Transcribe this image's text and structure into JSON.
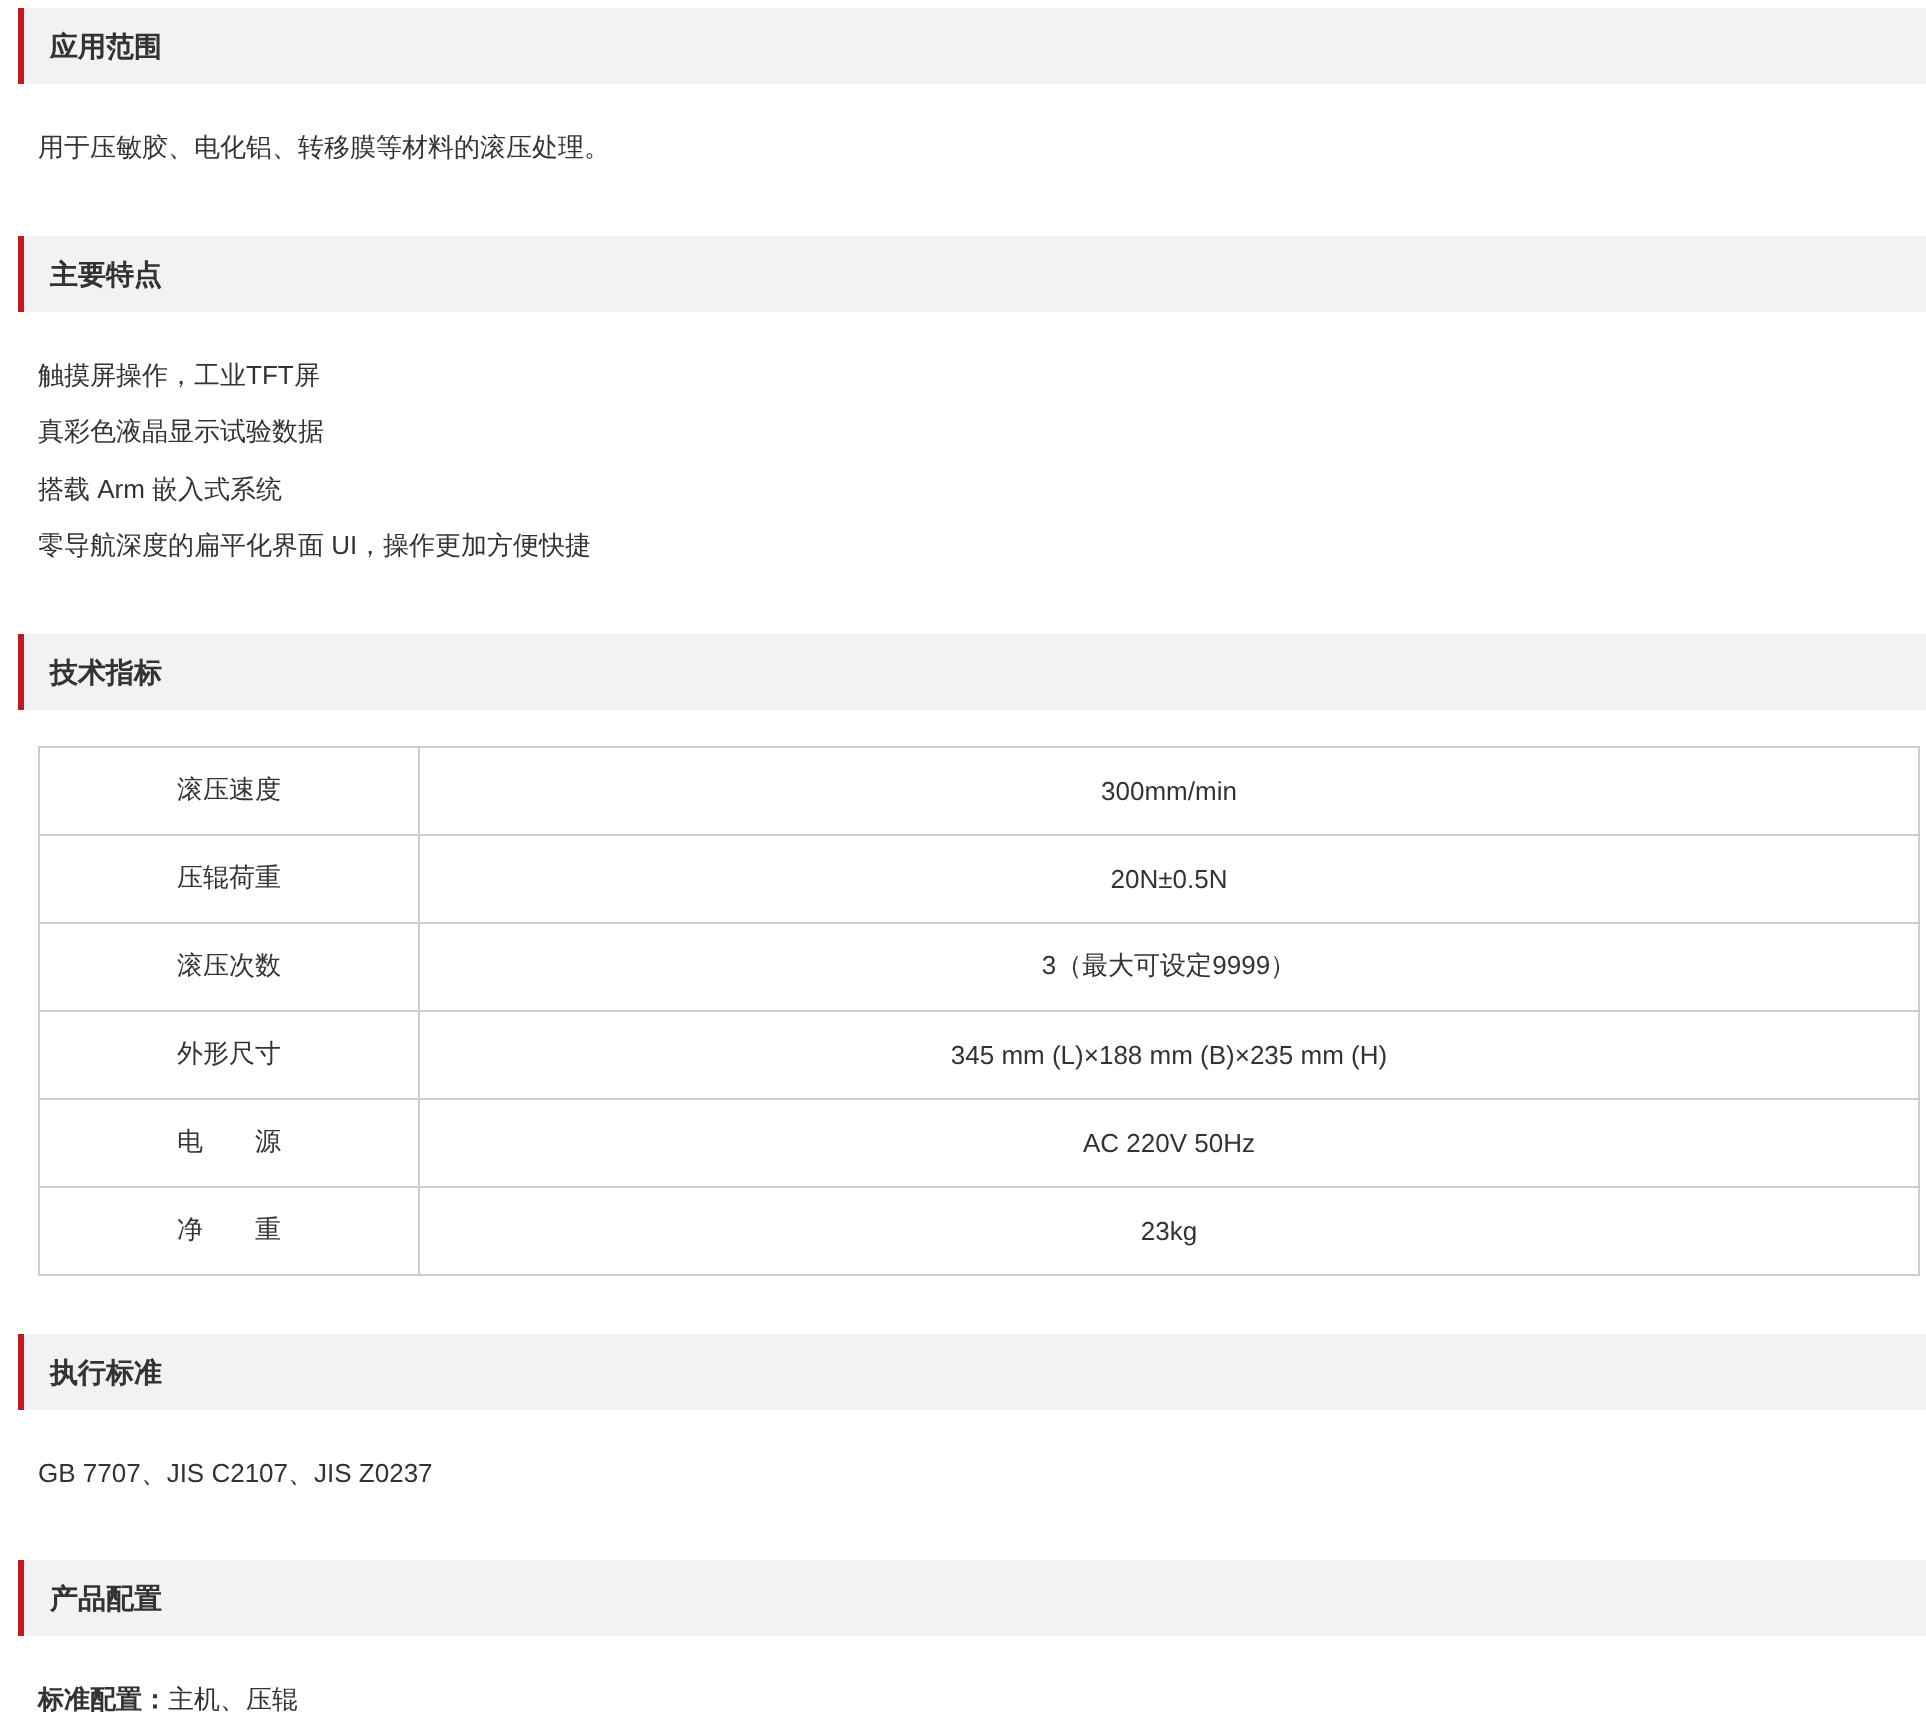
{
  "sections": [
    {
      "title": "应用范围",
      "kind": "lines",
      "lines": [
        "用于压敏胶、电化铝、转移膜等材料的滚压处理。"
      ]
    },
    {
      "title": "主要特点",
      "kind": "lines",
      "lines": [
        "触摸屏操作，工业TFT屏",
        "真彩色液晶显示试验数据",
        "搭载 Arm 嵌入式系统",
        "零导航深度的扁平化界面 UI，操作更加方便快捷"
      ]
    },
    {
      "title": "技术指标",
      "kind": "table",
      "rows": [
        {
          "label": "滚压速度",
          "value": "300mm/min"
        },
        {
          "label": "压辊荷重",
          "value": "20N±0.5N"
        },
        {
          "label": "滚压次数",
          "value": "3（最大可设定9999）"
        },
        {
          "label": "外形尺寸",
          "value": "345 mm (L)×188 mm (B)×235 mm (H)"
        },
        {
          "label": "电　　源",
          "value": "AC 220V 50Hz"
        },
        {
          "label": "净　　重",
          "value": "23kg"
        }
      ]
    },
    {
      "title": "执行标准",
      "kind": "lines",
      "lines": [
        "GB 7707、JIS C2107、JIS Z0237"
      ]
    },
    {
      "title": "产品配置",
      "kind": "lines",
      "lines": [
        "**标准配置：**主机、压辊"
      ]
    }
  ]
}
